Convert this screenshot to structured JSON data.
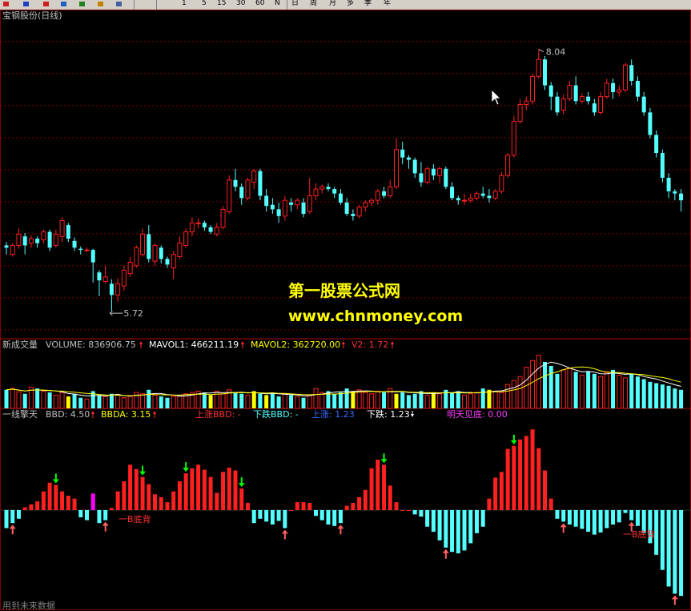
{
  "toolbar": {
    "icons": [
      "kd-icon",
      "ksi-icon",
      "s-icon",
      "move-icon",
      "add-icon",
      "pen-icon",
      "grid-icon"
    ],
    "periods": [
      "1",
      "5",
      "15",
      "30",
      "60",
      "N"
    ],
    "timeframes": [
      "日",
      "周",
      "月",
      "多",
      "季",
      "年"
    ]
  },
  "main_chart": {
    "title": "宝钢股份(日线)",
    "high_label": "8.04",
    "low_label": "5.72"
  },
  "volume_panel": {
    "name": "新成交量",
    "volume_text": "VOLUME: 836906.75",
    "mavol1_text": "MAVOL1: 466211.19",
    "mavol2_text": "MAVOL2: 362720.00",
    "v2_text": "V2: 1.72"
  },
  "indicator_panel": {
    "name": "一线擎天",
    "bbd_text": "BBD: 4.50",
    "bbda_text": "BBDA: 3.15",
    "up_bbd_text": "上涨BBD: -",
    "down_bbd_text": "下跌BBD: -",
    "up_text": "上涨: 1.23",
    "down_text": "下跌: 1.23",
    "tomorrow_text": "明天见底: 0.00",
    "annot_1": "一B底背",
    "annot_2": "一B底背"
  },
  "watermark": {
    "line1": "第一股票公式网",
    "line2": "www.chnmoney.com"
  },
  "status_text": "用到未来数据",
  "colors": {
    "up": "#ff2020",
    "down": "#54ffff",
    "grid": "#8b0000",
    "yellow": "#ffff00",
    "magenta": "#ff00ff",
    "arrow_green": "#00ff00",
    "arrow_red": "#ff6060"
  },
  "chart_data": {
    "type": "candlestick",
    "candles": [
      {
        "o": 6.3,
        "c": 6.28,
        "h": 6.33,
        "l": 6.22
      },
      {
        "o": 6.22,
        "c": 6.3,
        "h": 6.32,
        "l": 6.2
      },
      {
        "o": 6.3,
        "c": 6.4,
        "h": 6.45,
        "l": 6.27
      },
      {
        "o": 6.38,
        "c": 6.3,
        "h": 6.41,
        "l": 6.22
      },
      {
        "o": 6.32,
        "c": 6.36,
        "h": 6.39,
        "l": 6.28
      },
      {
        "o": 6.36,
        "c": 6.32,
        "h": 6.38,
        "l": 6.28
      },
      {
        "o": 6.35,
        "c": 6.42,
        "h": 6.44,
        "l": 6.32
      },
      {
        "o": 6.42,
        "c": 6.28,
        "h": 6.44,
        "l": 6.25
      },
      {
        "o": 6.3,
        "c": 6.4,
        "h": 6.44,
        "l": 6.28
      },
      {
        "o": 6.38,
        "c": 6.52,
        "h": 6.55,
        "l": 6.33
      },
      {
        "o": 6.48,
        "c": 6.36,
        "h": 6.5,
        "l": 6.33
      },
      {
        "o": 6.34,
        "c": 6.28,
        "h": 6.37,
        "l": 6.25
      },
      {
        "o": 6.27,
        "c": 6.26,
        "h": 6.29,
        "l": 6.22
      },
      {
        "o": 6.26,
        "c": 6.26,
        "h": 6.28,
        "l": 6.24
      },
      {
        "o": 6.26,
        "c": 6.15,
        "h": 6.27,
        "l": 5.97
      },
      {
        "o": 6.06,
        "c": 5.99,
        "h": 6.08,
        "l": 5.85
      },
      {
        "o": 5.98,
        "c": 6.02,
        "h": 6.12,
        "l": 5.96
      },
      {
        "o": 5.96,
        "c": 5.86,
        "h": 6.0,
        "l": 5.72
      },
      {
        "o": 5.86,
        "c": 5.96,
        "h": 6.01,
        "l": 5.8
      },
      {
        "o": 5.94,
        "c": 6.08,
        "h": 6.12,
        "l": 5.9
      },
      {
        "o": 6.05,
        "c": 6.15,
        "h": 6.2,
        "l": 6.02
      },
      {
        "o": 6.12,
        "c": 6.28,
        "h": 6.3,
        "l": 6.1
      },
      {
        "o": 6.22,
        "c": 6.4,
        "h": 6.45,
        "l": 6.2
      },
      {
        "o": 6.4,
        "c": 6.18,
        "h": 6.48,
        "l": 6.15
      },
      {
        "o": 6.16,
        "c": 6.3,
        "h": 6.32,
        "l": 6.12
      },
      {
        "o": 6.28,
        "c": 6.18,
        "h": 6.3,
        "l": 6.14
      },
      {
        "o": 6.18,
        "c": 6.13,
        "h": 6.2,
        "l": 6.1
      },
      {
        "o": 6.1,
        "c": 6.22,
        "h": 6.25,
        "l": 6.0
      },
      {
        "o": 6.2,
        "c": 6.32,
        "h": 6.38,
        "l": 6.18
      },
      {
        "o": 6.3,
        "c": 6.42,
        "h": 6.45,
        "l": 6.28
      },
      {
        "o": 6.42,
        "c": 6.5,
        "h": 6.55,
        "l": 6.38
      },
      {
        "o": 6.5,
        "c": 6.5,
        "h": 6.54,
        "l": 6.45
      },
      {
        "o": 6.5,
        "c": 6.46,
        "h": 6.52,
        "l": 6.43
      },
      {
        "o": 6.46,
        "c": 6.42,
        "h": 6.48,
        "l": 6.4
      },
      {
        "o": 6.4,
        "c": 6.46,
        "h": 6.5,
        "l": 6.38
      },
      {
        "o": 6.46,
        "c": 6.62,
        "h": 6.65,
        "l": 6.44
      },
      {
        "o": 6.6,
        "c": 6.88,
        "h": 6.92,
        "l": 6.58
      },
      {
        "o": 6.88,
        "c": 6.82,
        "h": 6.98,
        "l": 6.78
      },
      {
        "o": 6.82,
        "c": 6.72,
        "h": 6.85,
        "l": 6.66
      },
      {
        "o": 6.72,
        "c": 6.88,
        "h": 6.9,
        "l": 6.7
      },
      {
        "o": 6.86,
        "c": 6.96,
        "h": 6.98,
        "l": 6.8
      },
      {
        "o": 6.96,
        "c": 6.74,
        "h": 6.98,
        "l": 6.7
      },
      {
        "o": 6.74,
        "c": 6.65,
        "h": 6.8,
        "l": 6.6
      },
      {
        "o": 6.66,
        "c": 6.62,
        "h": 6.72,
        "l": 6.58
      },
      {
        "o": 6.62,
        "c": 6.56,
        "h": 6.68,
        "l": 6.5
      },
      {
        "o": 6.56,
        "c": 6.7,
        "h": 6.74,
        "l": 6.52
      },
      {
        "o": 6.68,
        "c": 6.66,
        "h": 6.72,
        "l": 6.6
      },
      {
        "o": 6.66,
        "c": 6.7,
        "h": 6.72,
        "l": 6.62
      },
      {
        "o": 6.68,
        "c": 6.58,
        "h": 6.72,
        "l": 6.55
      },
      {
        "o": 6.6,
        "c": 6.74,
        "h": 6.9,
        "l": 6.58
      },
      {
        "o": 6.74,
        "c": 6.8,
        "h": 6.85,
        "l": 6.7
      },
      {
        "o": 6.8,
        "c": 6.82,
        "h": 6.84,
        "l": 6.76
      },
      {
        "o": 6.82,
        "c": 6.8,
        "h": 6.85,
        "l": 6.78
      },
      {
        "o": 6.8,
        "c": 6.76,
        "h": 6.82,
        "l": 6.72
      },
      {
        "o": 6.76,
        "c": 6.68,
        "h": 6.8,
        "l": 6.66
      },
      {
        "o": 6.68,
        "c": 6.58,
        "h": 6.72,
        "l": 6.56
      },
      {
        "o": 6.58,
        "c": 6.56,
        "h": 6.62,
        "l": 6.52
      },
      {
        "o": 6.56,
        "c": 6.64,
        "h": 6.66,
        "l": 6.54
      },
      {
        "o": 6.64,
        "c": 6.68,
        "h": 6.7,
        "l": 6.6
      },
      {
        "o": 6.68,
        "c": 6.7,
        "h": 6.72,
        "l": 6.65
      },
      {
        "o": 6.7,
        "c": 6.78,
        "h": 6.8,
        "l": 6.66
      },
      {
        "o": 6.78,
        "c": 6.74,
        "h": 6.82,
        "l": 6.72
      },
      {
        "o": 6.74,
        "c": 6.82,
        "h": 6.88,
        "l": 6.72
      },
      {
        "o": 6.82,
        "c": 7.15,
        "h": 7.25,
        "l": 6.8
      },
      {
        "o": 7.15,
        "c": 7.08,
        "h": 7.22,
        "l": 7.02
      },
      {
        "o": 7.08,
        "c": 7.06,
        "h": 7.1,
        "l": 6.98
      },
      {
        "o": 7.06,
        "c": 6.94,
        "h": 7.08,
        "l": 6.9
      },
      {
        "o": 6.94,
        "c": 6.86,
        "h": 7.04,
        "l": 6.82
      },
      {
        "o": 6.86,
        "c": 6.98,
        "h": 7.0,
        "l": 6.84
      },
      {
        "o": 6.98,
        "c": 6.92,
        "h": 7.02,
        "l": 6.88
      },
      {
        "o": 6.92,
        "c": 6.98,
        "h": 7.0,
        "l": 6.85
      },
      {
        "o": 6.98,
        "c": 6.82,
        "h": 7.0,
        "l": 6.8
      },
      {
        "o": 6.82,
        "c": 6.72,
        "h": 6.86,
        "l": 6.7
      },
      {
        "o": 6.72,
        "c": 6.7,
        "h": 6.74,
        "l": 6.66
      },
      {
        "o": 6.7,
        "c": 6.7,
        "h": 6.76,
        "l": 6.66
      },
      {
        "o": 6.7,
        "c": 6.72,
        "h": 6.76,
        "l": 6.68
      },
      {
        "o": 6.72,
        "c": 6.76,
        "h": 6.78,
        "l": 6.7
      },
      {
        "o": 6.76,
        "c": 6.74,
        "h": 6.82,
        "l": 6.72
      },
      {
        "o": 6.74,
        "c": 6.72,
        "h": 6.8,
        "l": 6.68
      },
      {
        "o": 6.72,
        "c": 6.78,
        "h": 6.8,
        "l": 6.7
      },
      {
        "o": 6.78,
        "c": 6.92,
        "h": 6.95,
        "l": 6.76
      },
      {
        "o": 6.92,
        "c": 7.1,
        "h": 7.12,
        "l": 6.9
      },
      {
        "o": 7.1,
        "c": 7.4,
        "h": 7.45,
        "l": 7.08
      },
      {
        "o": 7.4,
        "c": 7.55,
        "h": 7.6,
        "l": 7.38
      },
      {
        "o": 7.55,
        "c": 7.58,
        "h": 7.62,
        "l": 7.5
      },
      {
        "o": 7.58,
        "c": 7.8,
        "h": 7.82,
        "l": 7.55
      },
      {
        "o": 7.8,
        "c": 7.95,
        "h": 8.04,
        "l": 7.78
      },
      {
        "o": 7.95,
        "c": 7.72,
        "h": 7.98,
        "l": 7.68
      },
      {
        "o": 7.72,
        "c": 7.62,
        "h": 7.75,
        "l": 7.5
      },
      {
        "o": 7.62,
        "c": 7.48,
        "h": 7.66,
        "l": 7.45
      },
      {
        "o": 7.5,
        "c": 7.6,
        "h": 7.64,
        "l": 7.46
      },
      {
        "o": 7.6,
        "c": 7.72,
        "h": 7.76,
        "l": 7.58
      },
      {
        "o": 7.72,
        "c": 7.58,
        "h": 7.8,
        "l": 7.55
      },
      {
        "o": 7.58,
        "c": 7.62,
        "h": 7.65,
        "l": 7.56
      },
      {
        "o": 7.62,
        "c": 7.58,
        "h": 7.66,
        "l": 7.55
      },
      {
        "o": 7.56,
        "c": 7.48,
        "h": 7.6,
        "l": 7.45
      },
      {
        "o": 7.48,
        "c": 7.62,
        "h": 7.66,
        "l": 7.46
      },
      {
        "o": 7.62,
        "c": 7.74,
        "h": 7.78,
        "l": 7.6
      },
      {
        "o": 7.74,
        "c": 7.66,
        "h": 7.78,
        "l": 7.6
      },
      {
        "o": 7.66,
        "c": 7.68,
        "h": 7.72,
        "l": 7.62
      },
      {
        "o": 7.68,
        "c": 7.9,
        "h": 7.92,
        "l": 7.66
      },
      {
        "o": 7.9,
        "c": 7.76,
        "h": 7.95,
        "l": 7.72
      },
      {
        "o": 7.76,
        "c": 7.62,
        "h": 7.8,
        "l": 7.58
      },
      {
        "o": 7.62,
        "c": 7.48,
        "h": 7.66,
        "l": 7.45
      },
      {
        "o": 7.48,
        "c": 7.28,
        "h": 7.52,
        "l": 7.25
      },
      {
        "o": 7.28,
        "c": 7.12,
        "h": 7.32,
        "l": 7.08
      },
      {
        "o": 7.12,
        "c": 6.9,
        "h": 7.15,
        "l": 6.86
      },
      {
        "o": 6.9,
        "c": 6.78,
        "h": 6.94,
        "l": 6.72
      },
      {
        "o": 6.78,
        "c": 6.76,
        "h": 6.8,
        "l": 6.7
      },
      {
        "o": 6.76,
        "c": 6.7,
        "h": 6.8,
        "l": 6.6
      }
    ],
    "volume": [
      28,
      30,
      25,
      22,
      32,
      30,
      26,
      24,
      20,
      24,
      18,
      22,
      16,
      14,
      26,
      20,
      18,
      22,
      20,
      16,
      18,
      24,
      22,
      28,
      20,
      18,
      16,
      18,
      20,
      22,
      24,
      26,
      24,
      20,
      26,
      22,
      28,
      24,
      22,
      20,
      26,
      22,
      20,
      24,
      18,
      22,
      20,
      18,
      16,
      20,
      30,
      24,
      26,
      22,
      24,
      30,
      26,
      28,
      24,
      22,
      26,
      24,
      30,
      22,
      24,
      20,
      22,
      26,
      20,
      24,
      22,
      28,
      24,
      26,
      20,
      22,
      24,
      30,
      28,
      26,
      24,
      36,
      42,
      48,
      62,
      72,
      80,
      70,
      64,
      52,
      58,
      60,
      55,
      50,
      56,
      52,
      48,
      54,
      58,
      50,
      46,
      52,
      48,
      44,
      40,
      38,
      36,
      34,
      30,
      28
    ],
    "volume_yellow": [
      10,
      33,
      40,
      42,
      56,
      63,
      69,
      78
    ],
    "bbd": [
      -2.5,
      -1.8,
      -1.2,
      0.4,
      0.8,
      1.2,
      2.6,
      3.8,
      3.5,
      2.6,
      2.0,
      1.6,
      -1.0,
      -1.4,
      2.3,
      -1.8,
      -1.4,
      0.3,
      2.6,
      4.0,
      6.3,
      5.7,
      4.6,
      3.6,
      2.2,
      1.8,
      1.1,
      2.6,
      4.0,
      5.1,
      5.8,
      6.3,
      5.6,
      4.6,
      2.4,
      5.3,
      5.9,
      5.5,
      3.0,
      1.0,
      -1.8,
      -1.2,
      -1.6,
      -2.0,
      -1.5,
      -2.5,
      0.0,
      1.1,
      1.1,
      1.0,
      -0.8,
      -1.4,
      -2.0,
      -2.2,
      -1.8,
      0.6,
      1.0,
      1.8,
      2.8,
      5.8,
      7.0,
      6.3,
      3.4,
      1.1,
      0.0,
      0.0,
      -0.6,
      -0.9,
      -2.3,
      -3.0,
      -4.2,
      -5.2,
      -5.8,
      -6.0,
      -5.6,
      -4.6,
      -3.2,
      -2.3,
      1.6,
      4.5,
      5.3,
      8.5,
      8.9,
      9.8,
      10.3,
      11.2,
      8.6,
      5.5,
      1.6,
      -1.2,
      -1.6,
      -2.0,
      -2.3,
      -2.6,
      -3.0,
      -3.4,
      -3.1,
      -2.5,
      -2.0,
      -1.7,
      -0.4,
      -1.4,
      -2.2,
      -3.2,
      -4.6,
      -6.2,
      -8.3,
      -10.6,
      -11.6,
      -11.9
    ],
    "bbd_magenta_index": 14,
    "green_arrow_indices": [
      8,
      22,
      29,
      38,
      61,
      82
    ],
    "red_arrow_indices": [
      1,
      16,
      45,
      54,
      71,
      90,
      101,
      108
    ]
  }
}
